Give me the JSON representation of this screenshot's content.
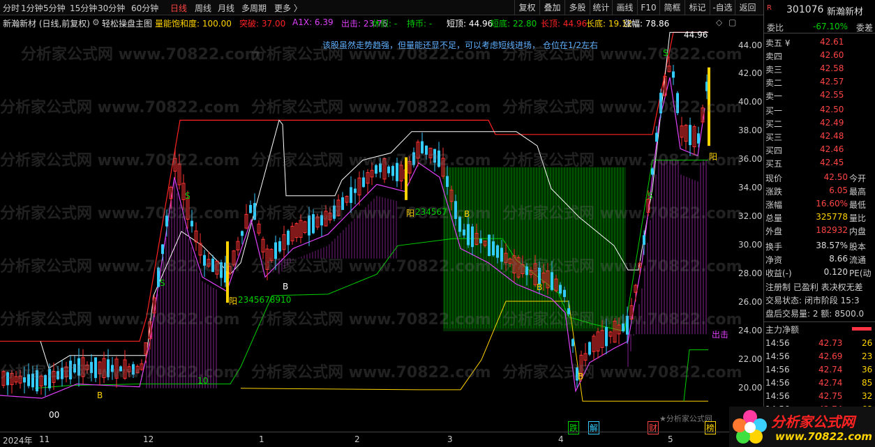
{
  "toolbar": {
    "tabs": [
      "分时",
      "1分钟",
      "5分钟",
      "15分钟",
      "30分钟",
      "60分钟",
      "日线",
      "周线",
      "月线",
      "多周期",
      "更多 〉"
    ],
    "active_tab": "日线",
    "right_buttons": [
      "复权",
      "叠加",
      "多股",
      "统计",
      "画线",
      "F10",
      "简框",
      "标记",
      "-自选",
      "返回"
    ]
  },
  "indicator_bar": {
    "stock": "新瀚新材 (日线,前复权)",
    "formula": "轻松操盘主图",
    "items": [
      {
        "label": "量能饱和度: 100.00",
        "color": "#ffd400"
      },
      {
        "label": "突破: 37.00",
        "color": "#ff2222"
      },
      {
        "label": "A1X: 6.39",
        "color": "#e040fb"
      },
      {
        "label": "出击: 23.76",
        "color": "#e040fb"
      },
      {
        "label": "休假: -",
        "color": "#00d000"
      },
      {
        "label": "持币: -",
        "color": "#00d000"
      },
      {
        "label": "短顶: 44.96",
        "color": "#ffffff"
      },
      {
        "label": "短底: 22.80",
        "color": "#00d000"
      },
      {
        "label": "长顶: 44.96",
        "color": "#ff2222"
      },
      {
        "label": "长底: 19.12",
        "color": "#ffd400"
      },
      {
        "label": "涨幅: 78.86",
        "color": "#ffffff"
      }
    ]
  },
  "annotation": "该股虽然走势趋强，但量能还显不足，可以考虑短线进场， 仓位在1/2左右",
  "price_axis": [
    "44.00",
    "42.00",
    "40.00",
    "38.00",
    "36.00",
    "34.00",
    "32.00",
    "30.00",
    "28.00",
    "26.00",
    "24.00",
    "22.00",
    "20.00"
  ],
  "time_axis": [
    "2024年",
    "11",
    "12",
    "1",
    "2",
    "3",
    "4",
    "5"
  ],
  "chart_labels": {
    "top_value": "44.96",
    "yang1": "阳",
    "seq1": "2345678910",
    "yang2": "阳",
    "seq2": "234567",
    "yang3": "阳",
    "chuji": "出击",
    "s_marks": [
      "S",
      "S",
      "S",
      "S"
    ],
    "b_marks": [
      "B",
      "B",
      "B",
      "B",
      "B"
    ],
    "ten": "10",
    "die": "跌",
    "jie": "解",
    "cai": "财",
    "bang": "榜",
    "bottom_val": "00",
    "watermark_small": "★分析家公式网",
    "watermark": "分析家公式网 www.70822.com"
  },
  "panel": {
    "code": "301076",
    "name": "新瀚新材",
    "weibi_label": "委比",
    "weibi_value": "-67.10%",
    "weicha_label": "委差",
    "asks": [
      {
        "label": "卖五 ¥",
        "price": "42.61"
      },
      {
        "label": "卖四",
        "price": "42.60"
      },
      {
        "label": "卖三",
        "price": "42.58"
      },
      {
        "label": "卖二",
        "price": "42.57"
      },
      {
        "label": "卖一",
        "price": "42.55"
      }
    ],
    "bids": [
      {
        "label": "买一",
        "price": "42.50"
      },
      {
        "label": "买二",
        "price": "42.49"
      },
      {
        "label": "买三",
        "price": "42.48"
      },
      {
        "label": "买四",
        "price": "42.46"
      },
      {
        "label": "买五",
        "price": "42.45"
      }
    ],
    "quotes": [
      {
        "label": "现价",
        "value": "42.50",
        "extra": "今开",
        "color": "#ff4444"
      },
      {
        "label": "涨跌",
        "value": "6.05",
        "extra": "最高",
        "color": "#ff4444"
      },
      {
        "label": "涨幅",
        "value": "16.60%",
        "extra": "最低",
        "color": "#ff4444"
      },
      {
        "label": "总量",
        "value": "325778",
        "extra": "量比",
        "color": "#ffd400"
      },
      {
        "label": "外盘",
        "value": "182932",
        "extra": "内盘",
        "color": "#ff4444"
      }
    ],
    "stats": [
      {
        "label": "换手",
        "value": "38.57%",
        "extra": "股本"
      },
      {
        "label": "净资",
        "value": "8.66",
        "extra": "流通"
      },
      {
        "label": "收益(-)",
        "value": "0.120",
        "extra": "PE(动"
      }
    ],
    "flags": "注册制 已盈利 表决权无差",
    "trade_status": "交易状态: 闭市阶段 15:3",
    "after_hours": "盘后交易量: 2  额: 8500.0",
    "net_flow_label": "主力净额",
    "ticks": [
      {
        "time": "14:56",
        "price": "42.73",
        "vol": "26"
      },
      {
        "time": "14:56",
        "price": "42.69",
        "vol": "23"
      },
      {
        "time": "14:56",
        "price": "42.74",
        "vol": "36"
      },
      {
        "time": "14:56",
        "price": "42.74",
        "vol": "85"
      },
      {
        "time": "14:56",
        "price": "42.75",
        "vol": "32"
      },
      {
        "time": "14:56",
        "price": "42.74",
        "vol": "68"
      }
    ],
    "logo_text": "分析家公式网",
    "logo_url": "www.70822.com"
  },
  "colors": {
    "up": "#ff3333",
    "down": "#33ccff",
    "accent": "#ffd400",
    "green": "#00d000",
    "magenta": "#e040fb"
  }
}
